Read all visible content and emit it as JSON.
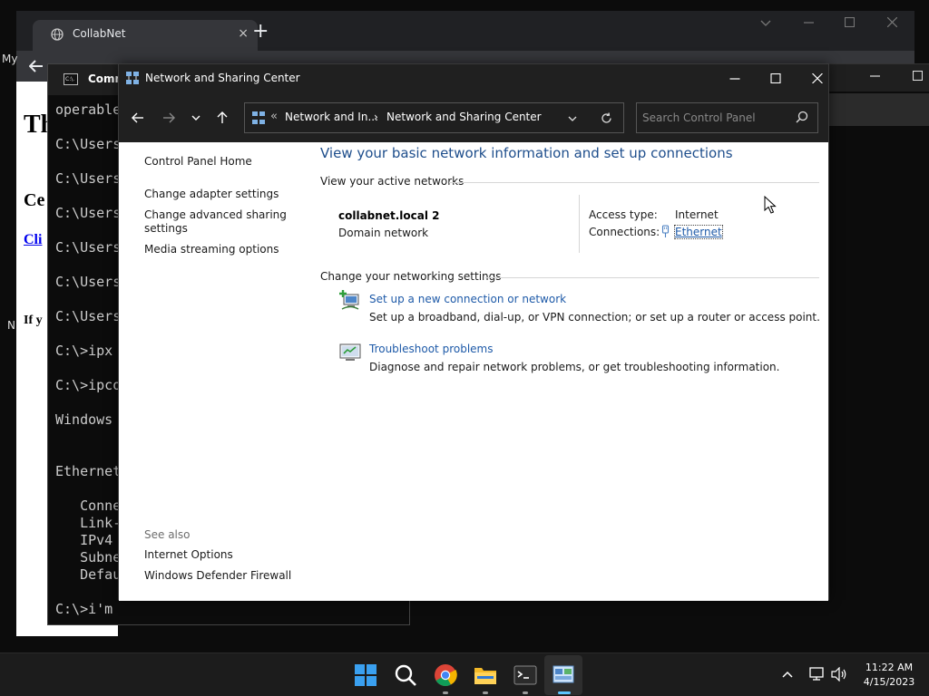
{
  "browser": {
    "tab_title": "CollabNet",
    "tab_close": "×",
    "new_tab": "+",
    "page": {
      "title_fragment": "Th",
      "heading_fragment": "Ce",
      "link_fragment": "Cli",
      "para_fragment": "If y"
    },
    "bg_label_my": "My",
    "bg_label_n": "N"
  },
  "cmd": {
    "title": "Comm",
    "icon_text": "C:\\.",
    "lines": [
      "operable",
      "C:\\Users",
      "C:\\Users",
      "C:\\Users",
      "C:\\Users",
      "C:\\Users",
      "C:\\Users",
      "C:\\>ipx",
      "C:\\>ipco",
      "Windows",
      "Ethernet",
      "   Conne",
      "   Link-",
      "   IPv4",
      "   Subne",
      "   Defau",
      "C:\\>i'm"
    ]
  },
  "nsc": {
    "title": "Network and Sharing Center",
    "address": {
      "sep": "«",
      "crumb1": "Network and In...",
      "arrow": "›",
      "crumb2": "Network and Sharing Center"
    },
    "search_placeholder": "Search Control Panel",
    "sidebar": {
      "home": "Control Panel Home",
      "adapter": "Change adapter settings",
      "advanced_line1": "Change advanced sharing",
      "advanced_line2": "settings",
      "media": "Media streaming options",
      "see_also": "See also",
      "internet_options": "Internet Options",
      "firewall": "Windows Defender Firewall"
    },
    "main": {
      "title": "View your basic network information and set up connections",
      "active_networks": "View your active networks",
      "network_name": "collabnet.local 2",
      "network_type": "Domain network",
      "access_label": "Access type:",
      "access_value": "Internet",
      "connections_label": "Connections:",
      "connections_value": "Ethernet",
      "change_settings": "Change your networking settings",
      "task1_link": "Set up a new connection or network",
      "task1_desc": "Set up a broadband, dial-up, or VPN connection; or set up a router or access point.",
      "task2_link": "Troubleshoot problems",
      "task2_desc": "Diagnose and repair network problems, or get troubleshooting information."
    }
  },
  "taskbar": {
    "time": "11:22 AM",
    "date": "4/15/2023"
  },
  "colors": {
    "link": "#1e5aa8",
    "title_blue": "#1e4e8c",
    "titlebar": "#202020",
    "taskbar": "#1c1c1c",
    "active_indicator": "#5cc6ff"
  }
}
